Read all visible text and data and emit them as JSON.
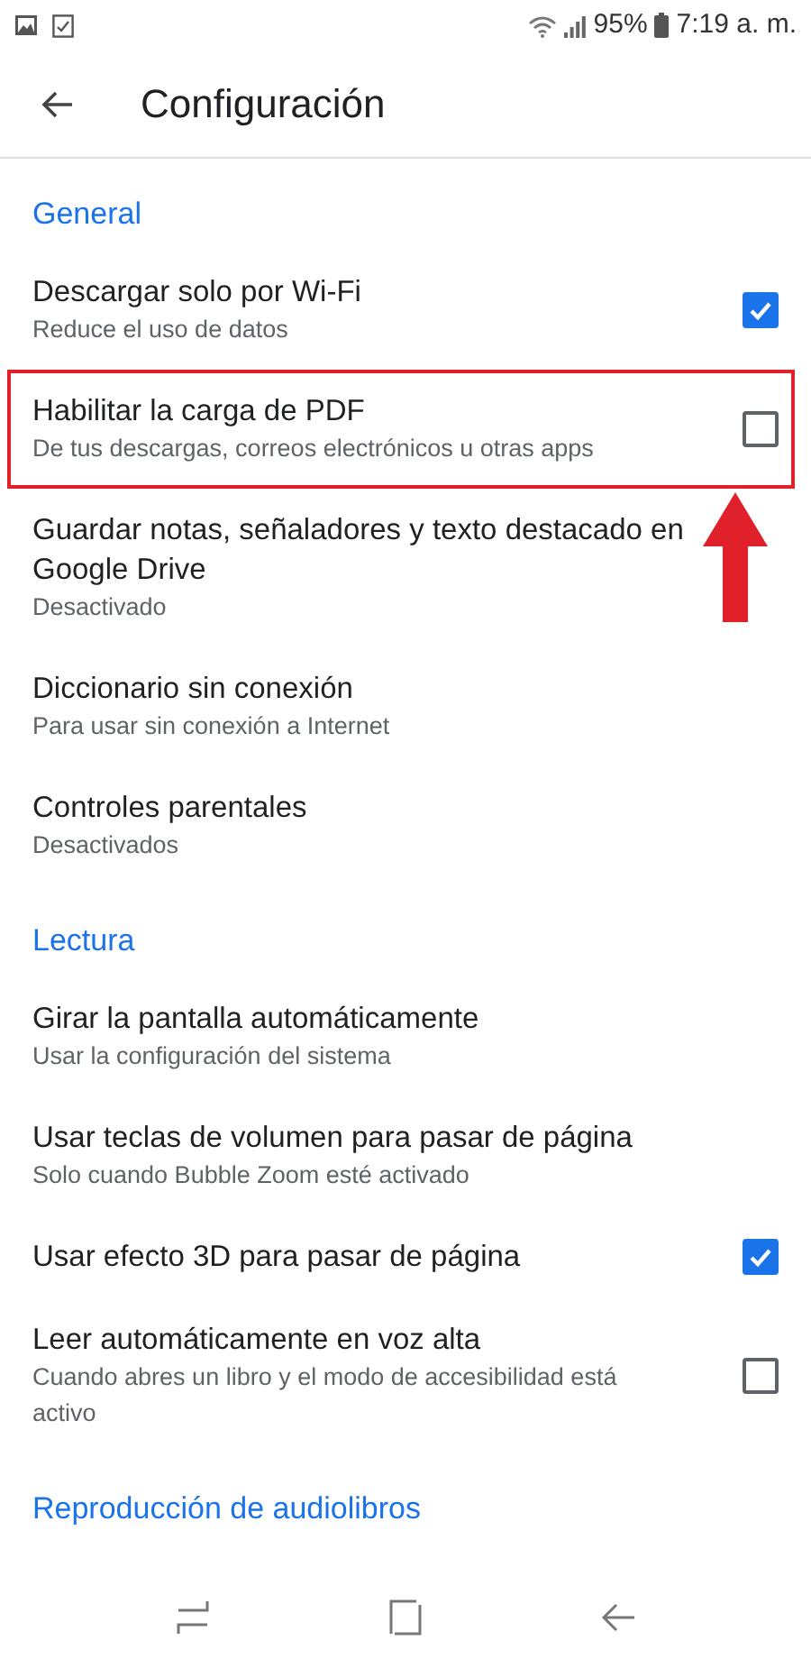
{
  "status_bar": {
    "battery_text": "95%",
    "time": "7:19 a. m."
  },
  "app_bar": {
    "title": "Configuración"
  },
  "sections": [
    {
      "header": "General",
      "items": [
        {
          "kind": "checkbox",
          "title": "Descargar solo por Wi‑Fi",
          "subtitle": "Reduce el uso de datos",
          "checked": true,
          "highlighted": false
        },
        {
          "kind": "checkbox",
          "title": "Habilitar la carga de PDF",
          "subtitle": "De tus descargas, correos electrónicos u otras apps",
          "checked": false,
          "highlighted": true
        },
        {
          "kind": "plain",
          "title": "Guardar notas, señaladores y texto destacado en Google Drive",
          "subtitle": "Desactivado"
        },
        {
          "kind": "plain",
          "title": "Diccionario sin conexión",
          "subtitle": "Para usar sin conexión a Internet"
        },
        {
          "kind": "plain",
          "title": "Controles parentales",
          "subtitle": "Desactivados"
        }
      ]
    },
    {
      "header": "Lectura",
      "items": [
        {
          "kind": "plain",
          "title": "Girar la pantalla automáticamente",
          "subtitle": "Usar la configuración del sistema"
        },
        {
          "kind": "plain",
          "title": "Usar teclas de volumen para pasar de página",
          "subtitle": "Solo cuando Bubble Zoom esté activado"
        },
        {
          "kind": "checkbox",
          "title": "Usar efecto 3D para pasar de página",
          "checked": true,
          "highlighted": false
        },
        {
          "kind": "checkbox",
          "title": "Leer automáticamente en voz alta",
          "subtitle": "Cuando abres un libro y el modo de accesibilidad está activo",
          "checked": false,
          "highlighted": false
        }
      ]
    },
    {
      "header": "Reproducción de audiolibros"
    }
  ]
}
